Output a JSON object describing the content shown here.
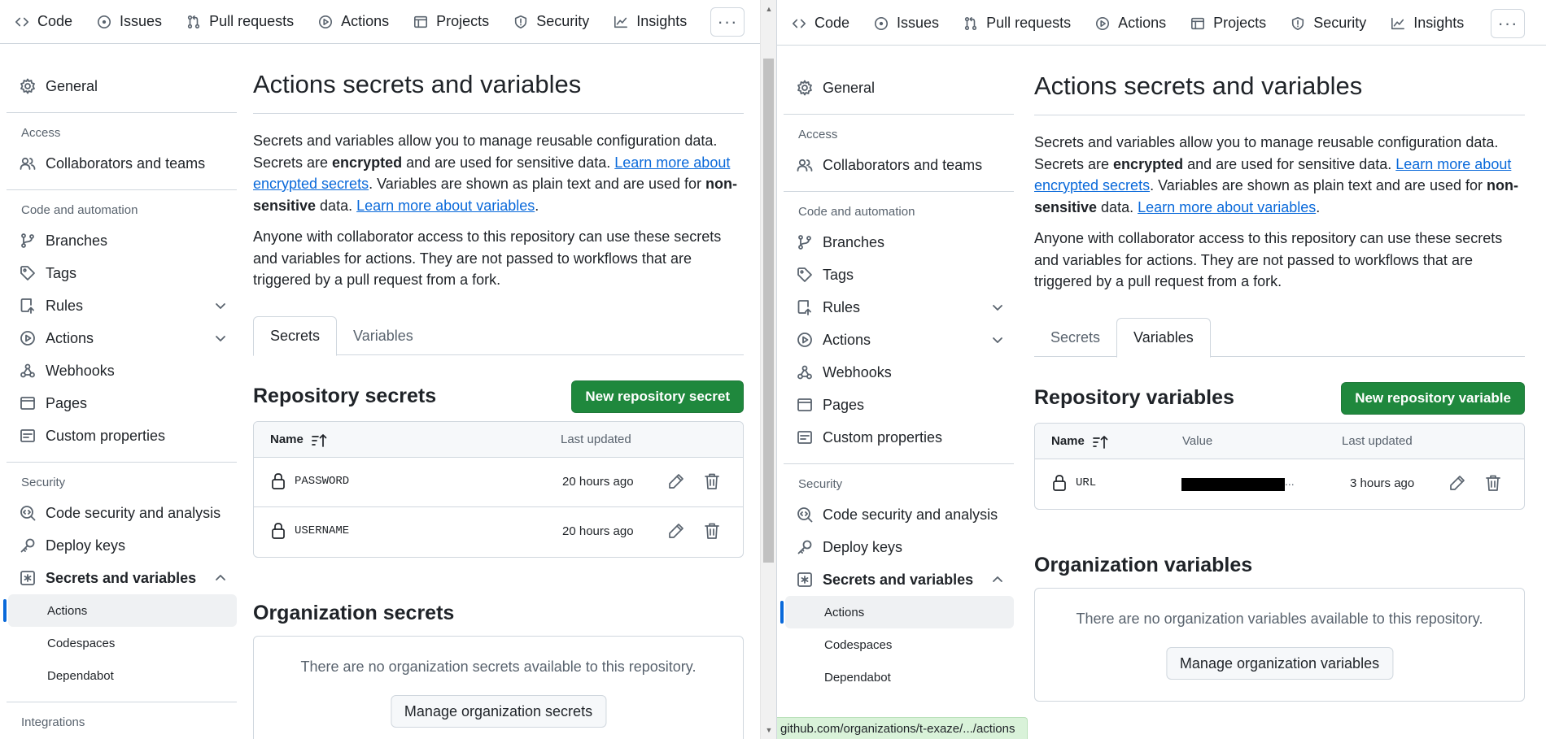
{
  "nav": {
    "code": "Code",
    "issues": "Issues",
    "pulls": "Pull requests",
    "actions": "Actions",
    "projects": "Projects",
    "security": "Security",
    "insights": "Insights",
    "more": "···"
  },
  "sidebar": {
    "general": "General",
    "access_heading": "Access",
    "collaborators": "Collaborators and teams",
    "code_automation_heading": "Code and automation",
    "branches": "Branches",
    "tags": "Tags",
    "rules": "Rules",
    "actions": "Actions",
    "webhooks": "Webhooks",
    "pages": "Pages",
    "custom_properties": "Custom properties",
    "security_heading": "Security",
    "code_security": "Code security and analysis",
    "deploy_keys": "Deploy keys",
    "secrets_variables": "Secrets and variables",
    "sub_actions": "Actions",
    "sub_codespaces": "Codespaces",
    "sub_dependabot": "Dependabot",
    "integrations_heading": "Integrations"
  },
  "page": {
    "title": "Actions secrets and variables",
    "desc1_a": "Secrets and variables allow you to manage reusable configuration data. Secrets are ",
    "desc1_b": "encrypted",
    "desc1_c": " and are used for sensitive data. ",
    "desc1_link1": "Learn more about encrypted secrets",
    "desc1_d": ". Variables are shown as plain text and are used for ",
    "desc1_e": "non-sensitive",
    "desc1_f": " data. ",
    "desc1_link2": "Learn more about variables",
    "desc1_g": ".",
    "desc2": "Anyone with collaborator access to this repository can use these secrets and variables for actions. They are not passed to workflows that are triggered by a pull request from a fork.",
    "tab_secrets": "Secrets",
    "tab_variables": "Variables"
  },
  "left": {
    "repo_title": "Repository secrets",
    "new_button": "New repository secret",
    "col_name": "Name",
    "col_updated": "Last updated",
    "rows": [
      {
        "name": "PASSWORD",
        "updated": "20 hours ago"
      },
      {
        "name": "USERNAME",
        "updated": "20 hours ago"
      }
    ],
    "org_title": "Organization secrets",
    "org_empty": "There are no organization secrets available to this repository.",
    "org_button": "Manage organization secrets"
  },
  "right": {
    "repo_title": "Repository variables",
    "new_button": "New repository variable",
    "col_name": "Name",
    "col_value": "Value",
    "col_updated": "Last updated",
    "rows": [
      {
        "name": "URL",
        "value_suffix": "...",
        "updated": "3 hours ago"
      }
    ],
    "org_title": "Organization variables",
    "org_empty": "There are no organization variables available to this repository.",
    "org_button": "Manage organization variables"
  },
  "status_url": "github.com/organizations/t-exaze/.../actions",
  "colors": {
    "primary_button": "#1f883d",
    "link": "#0969da",
    "selected_indicator": "#0969da"
  }
}
